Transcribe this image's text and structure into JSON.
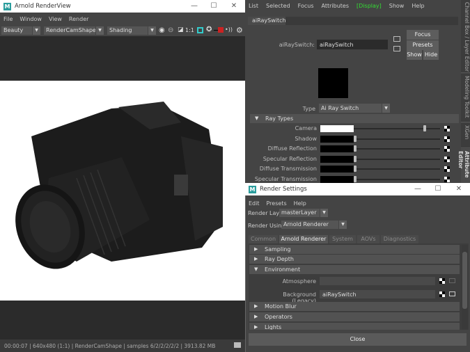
{
  "renderview": {
    "title": "Arnold RenderView",
    "menu": [
      "File",
      "Window",
      "View",
      "Render"
    ],
    "aov": "Beauty",
    "camera": "RenderCamShape",
    "mode": "Shading",
    "ratio": "1:1",
    "status": "00:00:07 | 640x480 (1:1) | RenderCamShape  | samples 6/2/2/2/2/2 | 3913.82 MB"
  },
  "attr": {
    "menu": [
      "List",
      "Selected",
      "Focus",
      "Attributes",
      "[Display]",
      "Show",
      "Help"
    ],
    "tab": "aiRaySwitch",
    "node_label": "aiRaySwitch:",
    "node_value": "aiRaySwitch",
    "focus": "Focus",
    "presets": "Presets",
    "show": "Show",
    "hide": "Hide",
    "type_label": "Type",
    "type_value": "Ai Ray Switch",
    "section": "Ray Types",
    "rays": [
      {
        "label": "Camera",
        "value": 1.0
      },
      {
        "label": "Shadow",
        "value": 0
      },
      {
        "label": "Diffuse Reflection",
        "value": 0
      },
      {
        "label": "Specular Reflection",
        "value": 0
      },
      {
        "label": "Diffuse Transmission",
        "value": 0
      },
      {
        "label": "Specular Transmission",
        "value": 0
      }
    ],
    "side_tabs": [
      "Channel Box / Layer Editor",
      "Modeling Toolkit",
      "XGen",
      "Attribute Editor"
    ]
  },
  "render_settings": {
    "title": "Render Settings",
    "menu": [
      "Edit",
      "Presets",
      "Help"
    ],
    "layer_label": "Render Layer",
    "layer_value": "masterLayer",
    "using_label": "Render Using",
    "using_value": "Arnold Renderer",
    "tabs": [
      "Common",
      "Arnold Renderer",
      "System",
      "AOVs",
      "Diagnostics"
    ],
    "sections": {
      "sampling": "Sampling",
      "ray_depth": "Ray Depth",
      "environment": "Environment",
      "motion_blur": "Motion Blur",
      "operators": "Operators",
      "lights": "Lights"
    },
    "atmosphere_label": "Atmosphere",
    "atmosphere_value": "",
    "background_label": "Background (Legacy)",
    "background_value": "aiRaySwitch",
    "close": "Close"
  }
}
